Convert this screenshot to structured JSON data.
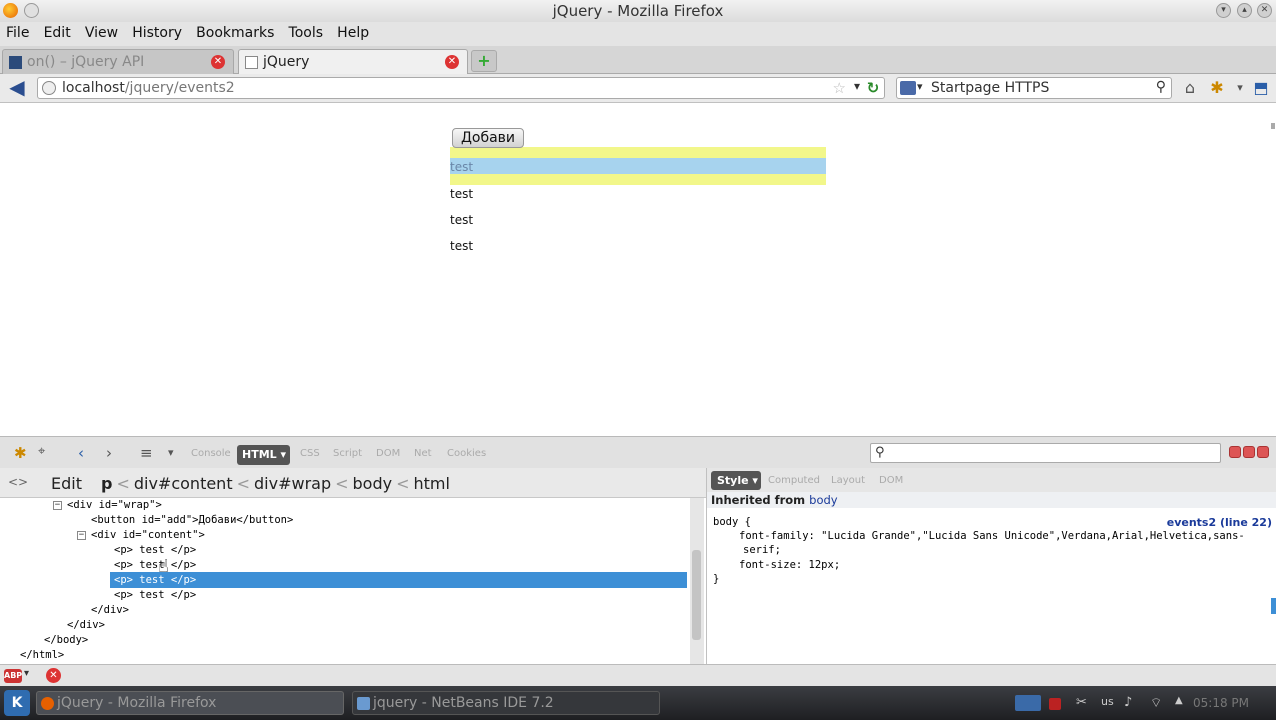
{
  "window": {
    "title": "jQuery - Mozilla Firefox"
  },
  "menu": [
    "File",
    "Edit",
    "View",
    "History",
    "Bookmarks",
    "Tools",
    "Help"
  ],
  "tabs": [
    {
      "label": "on() – jQuery API",
      "active": false
    },
    {
      "label": "jQuery",
      "active": true
    }
  ],
  "nav": {
    "url_host": "localhost",
    "url_path": "/jquery/events2",
    "search_engine": "Startpage HTTPS"
  },
  "page": {
    "add_button": "Добави",
    "paragraphs": [
      "test",
      "test",
      "test",
      "test"
    ]
  },
  "firebug": {
    "panels": [
      "Console",
      "HTML",
      "CSS",
      "Script",
      "DOM",
      "Net",
      "Cookies"
    ],
    "edit_label": "Edit",
    "breadcrumbs": [
      "p",
      "div#content",
      "div#wrap",
      "body",
      "html"
    ],
    "side_tabs": [
      "Style",
      "Computed",
      "Layout",
      "DOM"
    ],
    "inherited_label": "Inherited from",
    "inherited_from": "body",
    "css_source": "events2 (line 22)",
    "css_selector": "body {",
    "css_rule_1a": "font-family: \"Lucida Grande\",\"Lucida Sans Unicode\",Verdana,Arial,Helvetica,sans-",
    "css_rule_1b": "serif;",
    "css_rule_2": "font-size: 12px;",
    "css_close": "}",
    "html_lines": [
      "<div id=\"wrap\">",
      "<button id=\"add\">Добави</button>",
      "<div id=\"content\">",
      "<p> test </p>",
      "<p> test </p>",
      "<p> test </p>",
      "<p> test </p>",
      "</div>",
      "</div>",
      "</body>",
      "</html>"
    ]
  },
  "taskbar": {
    "tasks": [
      "jQuery - Mozilla Firefox",
      "jquery - NetBeans IDE 7.2"
    ],
    "clock": "05:18 PM",
    "tray_us": "us"
  },
  "colors": {
    "highlight_yellow": "#f2f78a",
    "highlight_blue": "#a7d3ee",
    "selected_row": "#3d8fd6"
  }
}
